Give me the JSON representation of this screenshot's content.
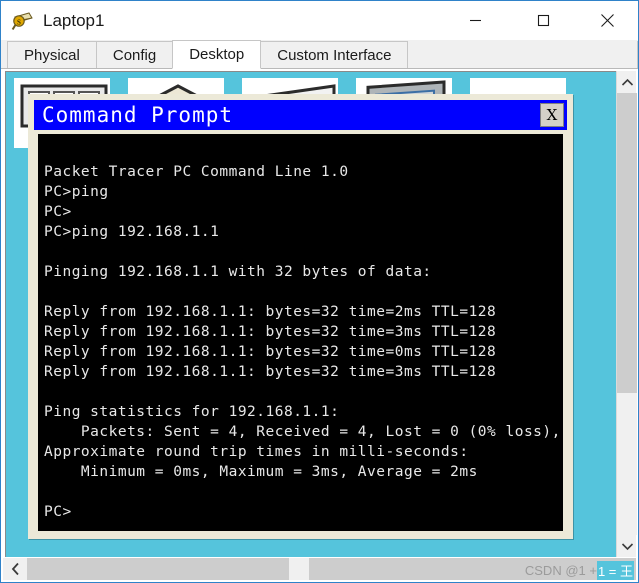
{
  "window": {
    "title": "Laptop1",
    "icon": "packet-tracer-device-icon",
    "controls": {
      "minimize": "minimize-icon",
      "maximize": "maximize-icon",
      "close": "close-icon"
    }
  },
  "tabs": [
    {
      "label": "Physical",
      "active": false
    },
    {
      "label": "Config",
      "active": false
    },
    {
      "label": "Desktop",
      "active": true
    },
    {
      "label": "Custom Interface",
      "active": false
    }
  ],
  "desktop": {
    "background_color": "#55c4dc",
    "icons": [
      {
        "name": "desktop-icon-1"
      },
      {
        "name": "desktop-icon-2"
      },
      {
        "name": "desktop-icon-3"
      },
      {
        "name": "desktop-icon-4"
      },
      {
        "name": "desktop-icon-5"
      }
    ]
  },
  "command_prompt": {
    "title": "Command Prompt",
    "titlebar_color": "#0000ff",
    "close_label": "X",
    "screen_background": "#000000",
    "text_color": "#e8e8e8",
    "lines": [
      "",
      "Packet Tracer PC Command Line 1.0",
      "PC>ping",
      "PC>",
      "PC>ping 192.168.1.1",
      "",
      "Pinging 192.168.1.1 with 32 bytes of data:",
      "",
      "Reply from 192.168.1.1: bytes=32 time=2ms TTL=128",
      "Reply from 192.168.1.1: bytes=32 time=3ms TTL=128",
      "Reply from 192.168.1.1: bytes=32 time=0ms TTL=128",
      "Reply from 192.168.1.1: bytes=32 time=3ms TTL=128",
      "",
      "Ping statistics for 192.168.1.1:",
      "    Packets: Sent = 4, Received = 4, Lost = 0 (0% loss),",
      "Approximate round trip times in milli-seconds:",
      "    Minimum = 0ms, Maximum = 3ms, Average = 2ms",
      "",
      "PC>"
    ],
    "text": "\nPacket Tracer PC Command Line 1.0\nPC>ping\nPC>\nPC>ping 192.168.1.1\n\nPinging 192.168.1.1 with 32 bytes of data:\n\nReply from 192.168.1.1: bytes=32 time=2ms TTL=128\nReply from 192.168.1.1: bytes=32 time=3ms TTL=128\nReply from 192.168.1.1: bytes=32 time=0ms TTL=128\nReply from 192.168.1.1: bytes=32 time=3ms TTL=128\n\nPing statistics for 192.168.1.1:\n    Packets: Sent = 4, Received = 4, Lost = 0 (0% loss),\nApproximate round trip times in milli-seconds:\n    Minimum = 0ms, Maximum = 3ms, Average = 2ms\n\nPC>"
  },
  "scrollbars": {
    "vertical": {
      "up": "chevron-up-icon",
      "down": "chevron-down-icon"
    },
    "horizontal": {
      "left": "chevron-left-icon"
    }
  },
  "watermark": {
    "prefix": "CSDN @1 + ",
    "highlighted": "1 = 王"
  }
}
